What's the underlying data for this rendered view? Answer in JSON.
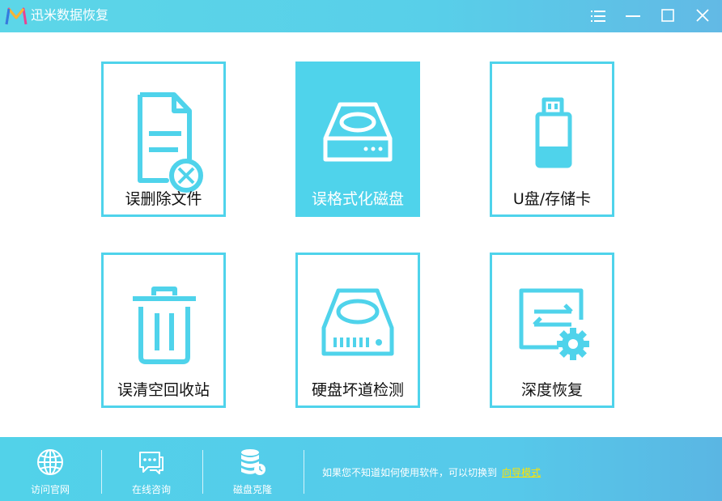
{
  "app": {
    "title": "迅米数据恢复"
  },
  "cards": [
    {
      "label": "误删除文件"
    },
    {
      "label": "误格式化磁盘"
    },
    {
      "label": "U盘/存储卡"
    },
    {
      "label": "误清空回收站"
    },
    {
      "label": "硬盘坏道检测"
    },
    {
      "label": "深度恢复"
    }
  ],
  "footer": {
    "items": [
      {
        "label": "访问官网"
      },
      {
        "label": "在线咨询"
      },
      {
        "label": "磁盘克隆"
      }
    ],
    "hint": "如果您不知道如何使用软件，可以切换到",
    "link": "向导模式"
  },
  "colors": {
    "accent": "#4fd3eb",
    "link": "#ffe400"
  },
  "icons": {
    "titlebar": [
      "menu-icon",
      "minimize-icon",
      "maximize-icon",
      "close-icon"
    ],
    "cards": [
      "deleted-file-icon",
      "disk-drive-icon",
      "usb-drive-icon",
      "trash-bin-icon",
      "hard-disk-icon",
      "deep-recovery-icon"
    ],
    "footer": [
      "globe-icon",
      "chat-icon",
      "database-clone-icon"
    ]
  }
}
